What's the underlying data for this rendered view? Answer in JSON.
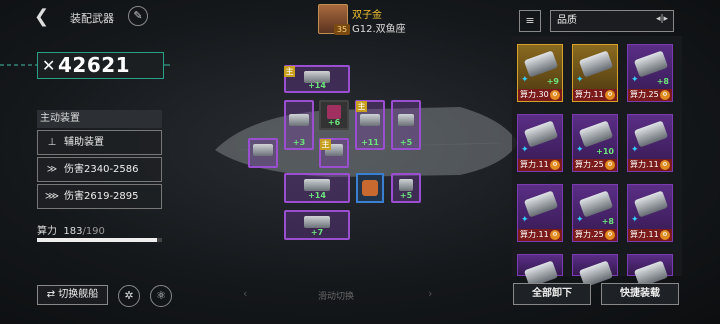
{
  "header": {
    "back_icon": "chevron-left-icon",
    "title": "装配武器",
    "edit_icon": "pencil-icon",
    "player_name": "双子金",
    "galaxy": "G12.双鱼座",
    "avatar_level": "35"
  },
  "power": {
    "icon": "crossed-swords-icon",
    "value": "42621"
  },
  "left_panel": {
    "section_title": "主动装置",
    "slots": [
      {
        "label": "辅助装置",
        "icon": "turret-icon"
      },
      {
        "label": "伤害2340-2586",
        "icon": "wing-icon"
      },
      {
        "label": "伤害2619-2895",
        "icon": "claw-icon"
      }
    ],
    "calc_label": "算力",
    "calc_current": "183",
    "calc_max": "/190",
    "calc_fraction": 0.963
  },
  "buttons": {
    "switch_ship": "切换舰船",
    "switch_icon": "swap-icon",
    "round1_icon": "fleet-icon",
    "round2_icon": "ship-icon",
    "swipe_hint": "滑动切换",
    "unequip_all": "全部卸下",
    "quick_equip": "快捷装载"
  },
  "equip_slots": [
    {
      "level": "+14",
      "main": true
    },
    {
      "level": "+3",
      "main": false
    },
    {
      "level": "+6",
      "main": false
    },
    {
      "level": "+11",
      "main": true
    },
    {
      "level": "+5",
      "main": false
    },
    {
      "level": "",
      "main": false
    },
    {
      "level": "",
      "main": true
    },
    {
      "level": "+14",
      "main": false
    },
    {
      "level": "+5",
      "main": false
    },
    {
      "level": "+7",
      "main": false
    }
  ],
  "main_tag": "主",
  "filter": {
    "icon": "filter-icon",
    "sort_label": "品质",
    "sort_icon": "sort-arrows-icon"
  },
  "inventory": [
    {
      "level": "+9",
      "calc": "算力.30",
      "gold": true
    },
    {
      "level": "",
      "calc": "算力.11",
      "gold": true
    },
    {
      "level": "+8",
      "calc": "算力.25",
      "gold": false
    },
    {
      "level": "",
      "calc": "算力.11",
      "gold": false
    },
    {
      "level": "+10",
      "calc": "算力.25",
      "gold": false
    },
    {
      "level": "",
      "calc": "算力.11",
      "gold": false
    },
    {
      "level": "",
      "calc": "算力.11",
      "gold": false
    },
    {
      "level": "+8",
      "calc": "算力.25",
      "gold": false
    },
    {
      "level": "",
      "calc": "算力.11",
      "gold": false
    },
    {
      "level": "",
      "calc": "",
      "gold": false
    },
    {
      "level": "",
      "calc": "",
      "gold": false
    },
    {
      "level": "",
      "calc": "",
      "gold": false
    }
  ]
}
